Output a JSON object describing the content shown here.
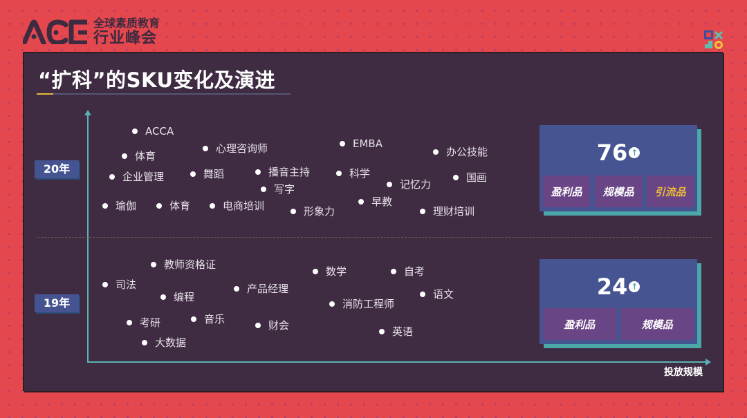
{
  "header": {
    "logo_mark": "ACE",
    "logo_line1": "全球素质教育",
    "logo_line2": "行业峰会",
    "corner_logo": "shapes-logo-icon"
  },
  "slide": {
    "title": "“扩科”的SKU变化及演进",
    "x_axis_label": "投放规模",
    "colors": {
      "background": "#e5474f",
      "panel": "#3f2b42",
      "axis": "#5bb3b3",
      "badge": "#455490",
      "tag": "#6a4586",
      "highlight": "#e7b93c"
    }
  },
  "rows": [
    {
      "year": "20年",
      "items": [
        "ACCA",
        "体育",
        "心理咨询师",
        "EMBA",
        "办公技能",
        "企业管理",
        "舞蹈",
        "播音主持",
        "科学",
        "记忆力",
        "国画",
        "写字",
        "瑜伽",
        "体育",
        "电商培训",
        "形象力",
        "早教",
        "理财培训"
      ],
      "stat": {
        "count": "76",
        "trend_icon": "arrow-up-icon",
        "tags": [
          "盈利品",
          "规模品",
          "引流品"
        ]
      }
    },
    {
      "year": "19年",
      "items": [
        "教师资格证",
        "司法",
        "编程",
        "产品经理",
        "数学",
        "自考",
        "语文",
        "消防工程师",
        "考研",
        "音乐",
        "财会",
        "大数据",
        "英语"
      ],
      "stat": {
        "count": "24",
        "trend_icon": "arrow-up-icon",
        "tags": [
          "盈利品",
          "规模品"
        ]
      }
    }
  ]
}
